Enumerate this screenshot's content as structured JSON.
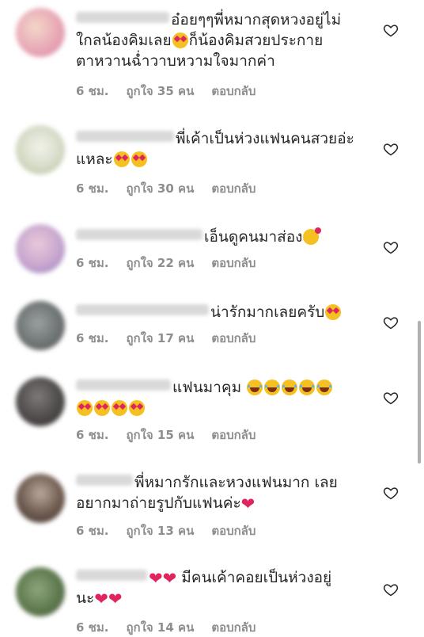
{
  "comments": [
    {
      "text_lines": [
        "อ๋อยๆๆพี่หมากสุดหวงอยู่ไม่",
        "ใกลน้องคิมเลย",
        "ก็น้องคิมสวยประกาย",
        "ตาหวานฉ่ำวาบหวามใจมากค่า"
      ],
      "time": "6 ชม.",
      "likes": "ถูกใจ 35 คน",
      "reply": "ตอบกลับ"
    },
    {
      "text_lines": [
        "พี่เค้าเป็นห่วงแฟนคนสวยอ่ะ",
        "แหละ"
      ],
      "time": "6 ชม.",
      "likes": "ถูกใจ 30 คน",
      "reply": "ตอบกลับ"
    },
    {
      "text_lines": [
        "เอ็นดูคนมาส่อง"
      ],
      "time": "6 ชม.",
      "likes": "ถูกใจ 22 คน",
      "reply": "ตอบกลับ"
    },
    {
      "text_lines": [
        "น่ารักมากเลยครับ"
      ],
      "time": "6 ชม.",
      "likes": "ถูกใจ 17 คน",
      "reply": "ตอบกลับ"
    },
    {
      "text_lines": [
        "แฟนมาคุม"
      ],
      "time": "6 ชม.",
      "likes": "ถูกใจ 15 คน",
      "reply": "ตอบกลับ"
    },
    {
      "text_lines": [
        "พี่หมากรักและหวงแฟนมาก เลย",
        "อยากมาถ่ายรูปกับแฟนค่ะ"
      ],
      "time": "6 ชม.",
      "likes": "ถูกใจ 13 คน",
      "reply": "ตอบกลับ"
    },
    {
      "text_lines": [
        "มีคนเค้าคอยเป็นห่วงอยู่",
        "นะ"
      ],
      "time": "6 ชม.",
      "likes": "ถูกใจ 14 คน",
      "reply": "ตอบกลับ"
    }
  ],
  "icons": {
    "like": "heart-outline-icon",
    "emoji_heart_eyes": "heart-eyes-emoji",
    "emoji_laughing": "tears-of-joy-emoji",
    "emoji_smiling_hearts": "smiling-hearts-emoji",
    "red_heart": "red-heart"
  },
  "colors": {
    "text": "#262626",
    "meta": "#8e8e8e",
    "heart_red": "#e0245e"
  }
}
